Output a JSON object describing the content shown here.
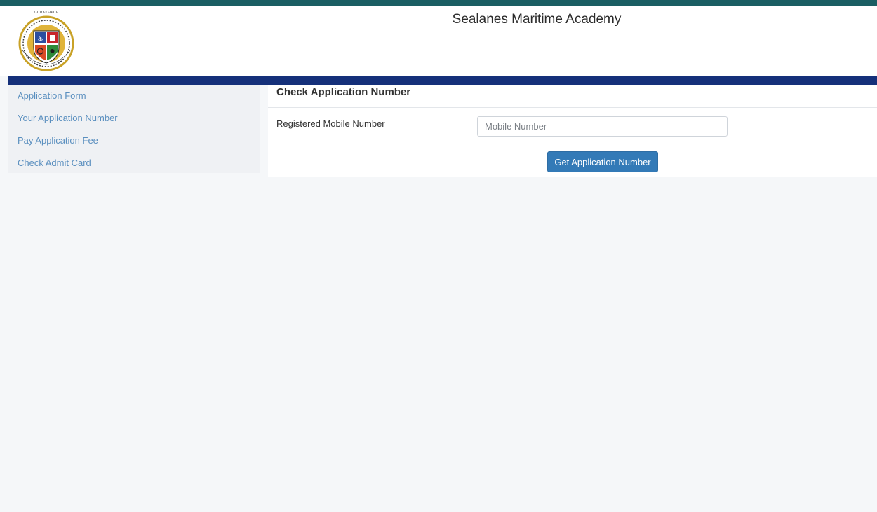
{
  "header": {
    "title": "Sealanes Maritime Academy",
    "logo_top_text": "GURAKHPUR",
    "logo_ring_text": "SEALANES MARITIME ACADEMY"
  },
  "sidebar": {
    "items": [
      {
        "label": "Application Form"
      },
      {
        "label": "Your Application Number"
      },
      {
        "label": "Pay Application Fee"
      },
      {
        "label": "Check Admit Card"
      }
    ]
  },
  "main": {
    "panel_title": "Check Application Number",
    "field_label": "Registered Mobile Number",
    "mobile_input": {
      "value": "",
      "placeholder": "Mobile Number"
    },
    "submit_label": "Get Application Number"
  },
  "colors": {
    "top_strip": "#1a5e63",
    "nav_bar": "#15307a",
    "link": "#5a8fbf",
    "button": "#337ab7"
  }
}
